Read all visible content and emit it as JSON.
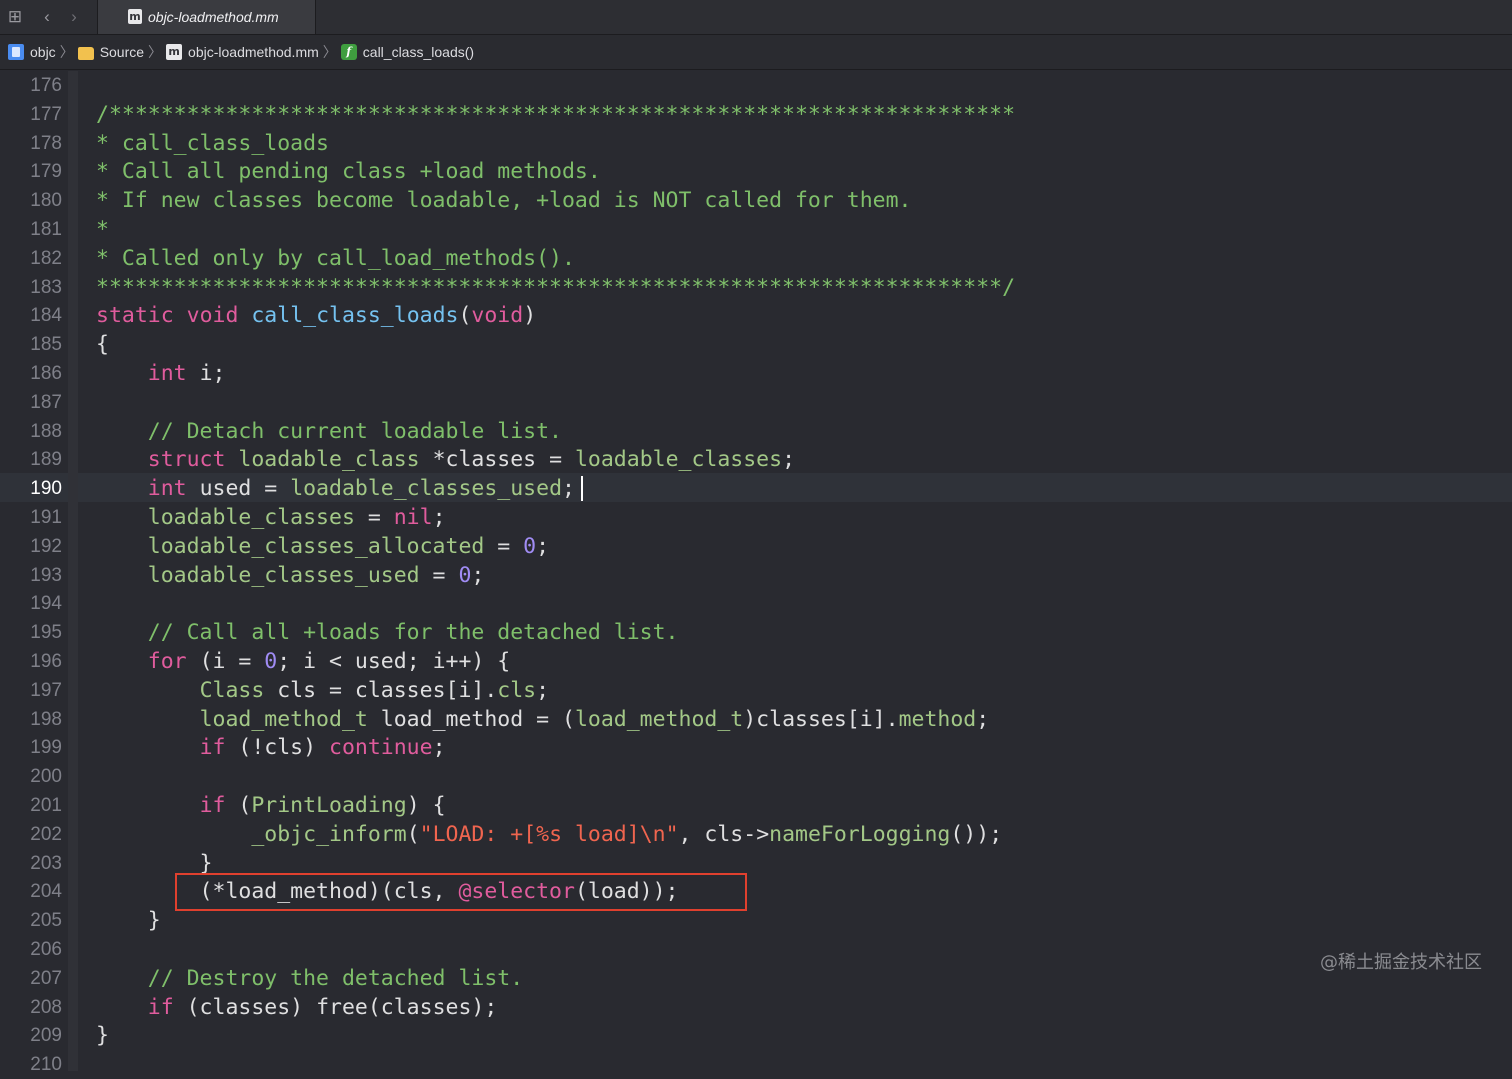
{
  "tabbar": {
    "active_tab": {
      "label": "objc-loadmethod.mm",
      "badge": "m"
    }
  },
  "breadcrumb": {
    "items": [
      {
        "label": "objc",
        "icon": "project-icon"
      },
      {
        "label": "Source",
        "icon": "folder-icon"
      },
      {
        "label": "objc-loadmethod.mm",
        "icon": "source-file-icon",
        "badge": "m"
      },
      {
        "label": "call_class_loads()",
        "icon": "function-icon",
        "badge": "f"
      }
    ],
    "separator": "〉"
  },
  "editor": {
    "current_line": "190",
    "lines": [
      {
        "num": "176",
        "segments": []
      },
      {
        "num": "177",
        "segments": [
          {
            "t": "/**********************************************************************",
            "c": "comment"
          }
        ]
      },
      {
        "num": "178",
        "segments": [
          {
            "t": "* call_class_loads",
            "c": "comment"
          }
        ]
      },
      {
        "num": "179",
        "segments": [
          {
            "t": "* Call all pending class +load methods.",
            "c": "comment"
          }
        ]
      },
      {
        "num": "180",
        "segments": [
          {
            "t": "* If new classes become loadable, +load is NOT called for them.",
            "c": "comment"
          }
        ]
      },
      {
        "num": "181",
        "segments": [
          {
            "t": "*",
            "c": "comment"
          }
        ]
      },
      {
        "num": "182",
        "segments": [
          {
            "t": "* Called only by call_load_methods().",
            "c": "comment"
          }
        ]
      },
      {
        "num": "183",
        "segments": [
          {
            "t": "**********************************************************************/",
            "c": "comment"
          }
        ]
      },
      {
        "num": "184",
        "segments": [
          {
            "t": "static",
            "c": "kw"
          },
          {
            "t": " ",
            "c": ""
          },
          {
            "t": "void",
            "c": "kw"
          },
          {
            "t": " ",
            "c": ""
          },
          {
            "t": "call_class_loads",
            "c": "fn2"
          },
          {
            "t": "(",
            "c": ""
          },
          {
            "t": "void",
            "c": "kw"
          },
          {
            "t": ")",
            "c": ""
          }
        ]
      },
      {
        "num": "185",
        "segments": [
          {
            "t": "{",
            "c": ""
          }
        ]
      },
      {
        "num": "186",
        "segments": [
          {
            "t": "    ",
            "c": ""
          },
          {
            "t": "int",
            "c": "kw"
          },
          {
            "t": " i;",
            "c": ""
          }
        ]
      },
      {
        "num": "187",
        "segments": []
      },
      {
        "num": "188",
        "segments": [
          {
            "t": "    ",
            "c": ""
          },
          {
            "t": "// Detach current loadable list.",
            "c": "comment"
          }
        ]
      },
      {
        "num": "189",
        "segments": [
          {
            "t": "    ",
            "c": ""
          },
          {
            "t": "struct",
            "c": "kw"
          },
          {
            "t": " ",
            "c": ""
          },
          {
            "t": "loadable_class",
            "c": "var"
          },
          {
            "t": " *classes = ",
            "c": ""
          },
          {
            "t": "loadable_classes",
            "c": "var"
          },
          {
            "t": ";",
            "c": ""
          }
        ]
      },
      {
        "num": "190",
        "segments": [
          {
            "t": "    ",
            "c": ""
          },
          {
            "t": "int",
            "c": "kw"
          },
          {
            "t": " used = ",
            "c": ""
          },
          {
            "t": "loadable_classes_used",
            "c": "var"
          },
          {
            "t": ";",
            "c": ""
          }
        ]
      },
      {
        "num": "191",
        "segments": [
          {
            "t": "    ",
            "c": ""
          },
          {
            "t": "loadable_classes",
            "c": "var"
          },
          {
            "t": " = ",
            "c": ""
          },
          {
            "t": "nil",
            "c": "kw"
          },
          {
            "t": ";",
            "c": ""
          }
        ]
      },
      {
        "num": "192",
        "segments": [
          {
            "t": "    ",
            "c": ""
          },
          {
            "t": "loadable_classes_allocated",
            "c": "var"
          },
          {
            "t": " = ",
            "c": ""
          },
          {
            "t": "0",
            "c": "num"
          },
          {
            "t": ";",
            "c": ""
          }
        ]
      },
      {
        "num": "193",
        "segments": [
          {
            "t": "    ",
            "c": ""
          },
          {
            "t": "loadable_classes_used",
            "c": "var"
          },
          {
            "t": " = ",
            "c": ""
          },
          {
            "t": "0",
            "c": "num"
          },
          {
            "t": ";",
            "c": ""
          }
        ]
      },
      {
        "num": "194",
        "segments": []
      },
      {
        "num": "195",
        "segments": [
          {
            "t": "    ",
            "c": ""
          },
          {
            "t": "// Call all +loads for the detached list.",
            "c": "comment"
          }
        ]
      },
      {
        "num": "196",
        "segments": [
          {
            "t": "    ",
            "c": ""
          },
          {
            "t": "for",
            "c": "kw"
          },
          {
            "t": " (i = ",
            "c": ""
          },
          {
            "t": "0",
            "c": "num"
          },
          {
            "t": "; i < used; i++) {",
            "c": ""
          }
        ]
      },
      {
        "num": "197",
        "segments": [
          {
            "t": "        ",
            "c": ""
          },
          {
            "t": "Class",
            "c": "var"
          },
          {
            "t": " cls = classes[i].",
            "c": ""
          },
          {
            "t": "cls",
            "c": "var"
          },
          {
            "t": ";",
            "c": ""
          }
        ]
      },
      {
        "num": "198",
        "segments": [
          {
            "t": "        ",
            "c": ""
          },
          {
            "t": "load_method_t",
            "c": "var"
          },
          {
            "t": " load_method = (",
            "c": ""
          },
          {
            "t": "load_method_t",
            "c": "var"
          },
          {
            "t": ")classes[i].",
            "c": ""
          },
          {
            "t": "method",
            "c": "var"
          },
          {
            "t": ";",
            "c": ""
          }
        ]
      },
      {
        "num": "199",
        "segments": [
          {
            "t": "        ",
            "c": ""
          },
          {
            "t": "if",
            "c": "kw"
          },
          {
            "t": " (!cls) ",
            "c": ""
          },
          {
            "t": "continue",
            "c": "kw"
          },
          {
            "t": ";",
            "c": ""
          }
        ]
      },
      {
        "num": "200",
        "segments": []
      },
      {
        "num": "201",
        "segments": [
          {
            "t": "        ",
            "c": ""
          },
          {
            "t": "if",
            "c": "kw"
          },
          {
            "t": " (",
            "c": ""
          },
          {
            "t": "PrintLoading",
            "c": "var"
          },
          {
            "t": ") {",
            "c": ""
          }
        ]
      },
      {
        "num": "202",
        "segments": [
          {
            "t": "            ",
            "c": ""
          },
          {
            "t": "_objc_inform",
            "c": "var"
          },
          {
            "t": "(",
            "c": ""
          },
          {
            "t": "\"LOAD: +[%s load]\\n\"",
            "c": "str"
          },
          {
            "t": ", cls->",
            "c": ""
          },
          {
            "t": "nameForLogging",
            "c": "var"
          },
          {
            "t": "());",
            "c": ""
          }
        ]
      },
      {
        "num": "203",
        "segments": [
          {
            "t": "        }",
            "c": ""
          }
        ]
      },
      {
        "num": "204",
        "segments": [
          {
            "t": "        (*load_method)(cls, ",
            "c": ""
          },
          {
            "t": "@selector",
            "c": "kw"
          },
          {
            "t": "(load));",
            "c": ""
          }
        ]
      },
      {
        "num": "205",
        "segments": [
          {
            "t": "    }",
            "c": ""
          }
        ]
      },
      {
        "num": "206",
        "segments": []
      },
      {
        "num": "207",
        "segments": [
          {
            "t": "    ",
            "c": ""
          },
          {
            "t": "// Destroy the detached list.",
            "c": "comment"
          }
        ]
      },
      {
        "num": "208",
        "segments": [
          {
            "t": "    ",
            "c": ""
          },
          {
            "t": "if",
            "c": "kw"
          },
          {
            "t": " (classes) ",
            "c": ""
          },
          {
            "t": "free",
            "c": ""
          },
          {
            "t": "(classes);",
            "c": ""
          }
        ]
      },
      {
        "num": "209",
        "segments": [
          {
            "t": "}",
            "c": ""
          }
        ]
      },
      {
        "num": "210",
        "segments": []
      }
    ]
  },
  "colors": {
    "background": "#292a30",
    "comment": "#7fbf6a",
    "keyword": "#e05c9d",
    "function_decl": "#75c2f0",
    "project_symbol": "#a3c887",
    "number": "#a08cf4",
    "string": "#f0654f",
    "highlight_box": "#e0402e"
  },
  "watermark": "@稀土掘金技术社区"
}
